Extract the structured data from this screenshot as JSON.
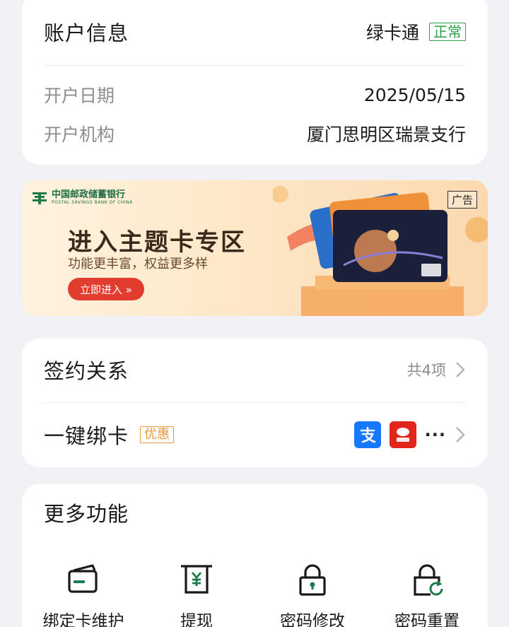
{
  "account": {
    "title": "账户信息",
    "type": "绿卡通",
    "status": "正常",
    "rows": [
      {
        "label": "开户日期",
        "value": "2025/05/15"
      },
      {
        "label": "开户机构",
        "value": "厦门思明区瑞景支行"
      }
    ]
  },
  "banner": {
    "bank_name_cn": "中国邮政储蓄银行",
    "bank_name_en": "POSTAL SAVINGS BANK OF CHINA",
    "ad_tag": "广告",
    "title": "进入主题卡专区",
    "subtitle": "功能更丰富，权益更多样",
    "button": "立即进入 »"
  },
  "bindings": {
    "sign_title": "签约关系",
    "sign_count": "共4项",
    "bind_title": "一键绑卡",
    "promo": "优惠",
    "pay_icons": [
      "alipay-icon",
      "jd-icon"
    ],
    "more": "···"
  },
  "features": {
    "title": "更多功能",
    "items": [
      {
        "label": "绑定卡维护",
        "icon": "card-icon"
      },
      {
        "label": "提现",
        "icon": "withdraw-icon"
      },
      {
        "label": "密码修改",
        "icon": "lock-icon"
      },
      {
        "label": "密码重置",
        "icon": "lock-reset-icon"
      }
    ]
  },
  "colors": {
    "brand_green": "#1f7a4a",
    "status_green": "#2aa048",
    "promo_orange": "#e89a3c",
    "button_red": "#e23c2f"
  }
}
